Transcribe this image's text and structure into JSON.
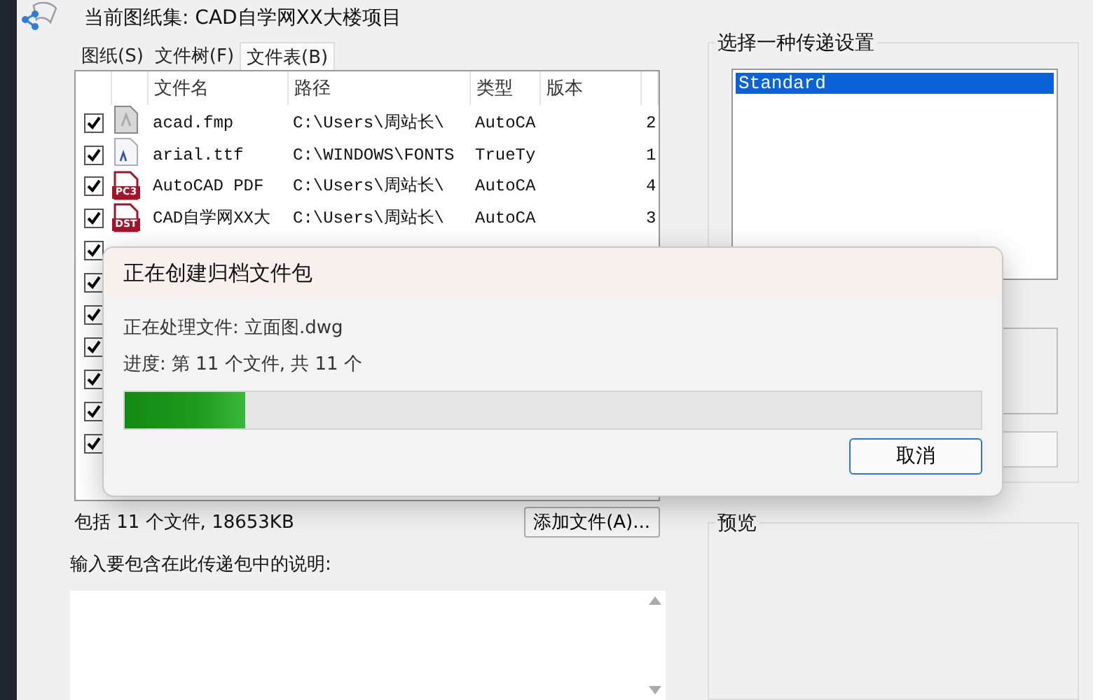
{
  "header": {
    "title": "当前图纸集: CAD自学网XX大楼项目"
  },
  "tabs": [
    {
      "label": "图纸(S)",
      "selected": false
    },
    {
      "label": "文件树(F)",
      "selected": false
    },
    {
      "label": "文件表(B)",
      "selected": true
    }
  ],
  "table": {
    "columns": [
      "文件名",
      "路径",
      "类型",
      "版本"
    ],
    "rows": [
      {
        "checked": true,
        "kind": "generic",
        "name": "acad.fmp",
        "path": "C:\\Users\\周站长\\",
        "type": "AutoCA",
        "column_5": "2"
      },
      {
        "checked": true,
        "kind": "font",
        "name": "arial.ttf",
        "path": "C:\\WINDOWS\\FONTS",
        "type": "TrueTy",
        "column_5": "1"
      },
      {
        "checked": true,
        "kind": "red",
        "icon_label": "PC3",
        "name": "AutoCAD PDF",
        "path": "C:\\Users\\周站长\\",
        "type": "AutoCA",
        "column_5": "4"
      },
      {
        "checked": true,
        "kind": "red",
        "icon_label": "DST",
        "name": "CAD自学网XX大",
        "path": "C:\\Users\\周站长\\",
        "type": "AutoCA",
        "column_5": "3"
      },
      {
        "checked": true
      },
      {
        "checked": true
      },
      {
        "checked": true
      },
      {
        "checked": true
      },
      {
        "checked": true
      },
      {
        "checked": true
      },
      {
        "checked": true
      }
    ]
  },
  "summary": "包括 11 个文件, 18653KB",
  "add_button": "添加文件(A)...",
  "notes_label": "输入要包含在此传递包中的说明:",
  "transmittal_setups": {
    "title": "选择一种传递设置",
    "items": [
      {
        "label": "Standard",
        "selected": true
      }
    ]
  },
  "preview": {
    "title": "预览"
  },
  "dialog": {
    "title": "正在创建归档文件包",
    "current_file": "正在处理文件: 立面图.dwg",
    "progress_text": "进度: 第 11 个文件, 共 11 个",
    "level": 0.14,
    "cancel": "取消"
  }
}
